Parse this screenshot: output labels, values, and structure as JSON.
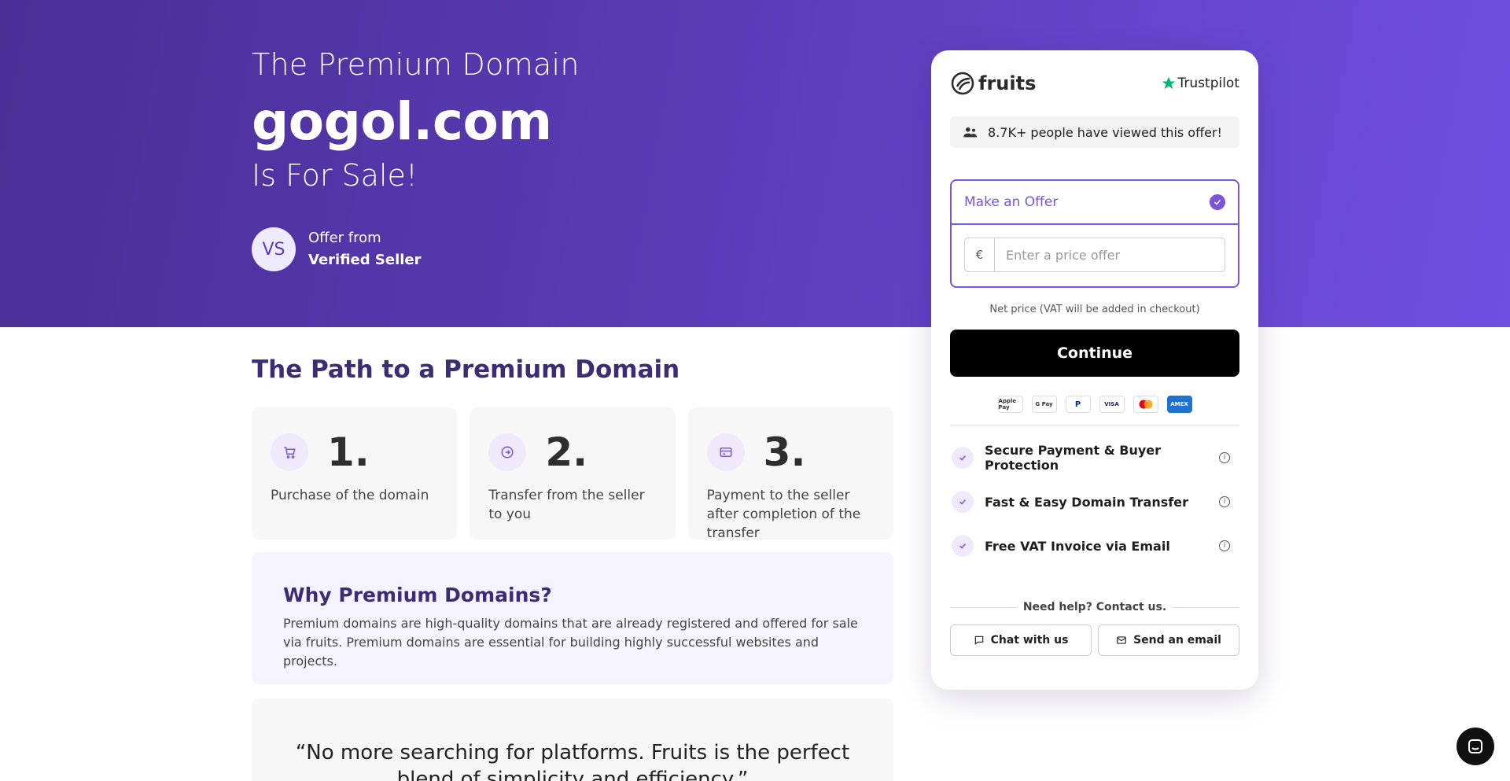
{
  "hero": {
    "subtitle": "The Premium Domain",
    "domain": "gogol.com",
    "tagline": "Is For Sale!",
    "seller_initials": "VS",
    "offer_from": "Offer from",
    "seller_name": "Verified Seller"
  },
  "path": {
    "title": "The Path to a Premium Domain",
    "steps": [
      {
        "number": "1.",
        "text": "Purchase of the domain",
        "icon": "cart-icon"
      },
      {
        "number": "2.",
        "text": "Transfer from the seller to you",
        "icon": "arrow-circle-icon"
      },
      {
        "number": "3.",
        "text": "Payment to the seller after completion of the transfer",
        "icon": "card-icon"
      }
    ]
  },
  "why": {
    "title": "Why Premium Domains?",
    "text": "Premium domains are high-quality domains that are already registered and offered for sale via fruits. Premium domains are essential for building highly successful websites and projects."
  },
  "quote": {
    "text": "“No more searching for platforms. Fruits is the perfect blend of simplicity and efficiency.”"
  },
  "card": {
    "brand": "fruits",
    "trustpilot": "Trustpilot",
    "viewed": "8.7K+ people have viewed this offer!",
    "offer_label": "Make an Offer",
    "currency": "€",
    "price_placeholder": "Enter a price offer",
    "net_note": "Net price (VAT will be added in checkout)",
    "continue_label": "Continue",
    "payments": [
      "Apple Pay",
      "G Pay",
      "PayPal",
      "VISA",
      "Mastercard",
      "AMEX"
    ],
    "features": [
      "Secure Payment & Buyer Protection",
      "Fast & Easy Domain Transfer",
      "Free VAT Invoice via Email"
    ],
    "help_label": "Need help? Contact us.",
    "chat_label": "Chat with us",
    "email_label": "Send an email"
  },
  "colors": {
    "accent": "#7b55d6",
    "hero_start": "#4a2f95",
    "hero_end": "#6f4fe0",
    "title": "#3b2d74"
  }
}
